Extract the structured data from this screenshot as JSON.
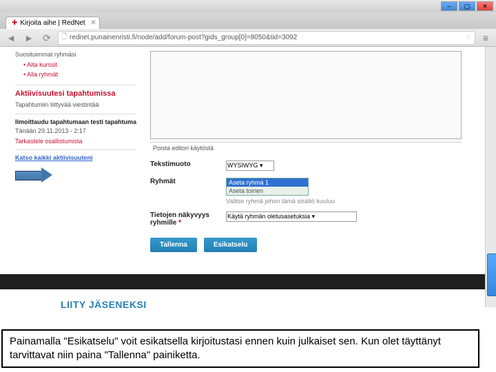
{
  "chrome": {
    "tab_title": "Kirjoita aihe | RedNet",
    "url": "rednet.punainenristi.fi/node/add/forum-post?gids_group[0]=8050&tid=3092",
    "win_min": "–",
    "win_max": "▢",
    "win_close": "✕",
    "tab_close": "✕",
    "back": "◄",
    "fwd": "►",
    "reload": "⟳",
    "star": "☆",
    "menu": "≡"
  },
  "sidebar": {
    "sub": "Suosituimmat ryhmäsi",
    "bullets": [
      "Alta kurssit",
      "Alla ryhmät"
    ],
    "activity_heading": "Aktiivisuutesi tapahtumissa",
    "activity_sub": "Tapahtumiin liittyvää viestintää",
    "signup_heading": "Ilmoittaudu tapahtumaan testi tapahtuma",
    "signup_date": "Tänään 29.11.2013 - 2:17",
    "view_participants": "Tarkastele osallistumista",
    "view_all": "Katso kaikki aktiivisuuteni"
  },
  "form": {
    "toggle_editor": "Poista editori käytöstä",
    "text_format_label": "Tekstimuoto",
    "text_format_value": "WYSIWYG ▾",
    "groups_label": "Ryhmät",
    "group_selected": "Aseta ryhmä 1",
    "group_opt": "Aseta toinen",
    "groups_hint": "Valitse ryhmä johon tämä sisältö kuuluu",
    "visibility_label": "Tietojen näkyvyys ryhmille",
    "visibility_value": "Käytä ryhmän oletusasetuksia ▾",
    "save": "Tallenna",
    "preview": "Esikatselu"
  },
  "footer": {
    "join": "LIITY JÄSENEKSI"
  },
  "overlay": {
    "text": "Painamalla \"Esikatselu\" voit esikatsella kirjoitustasi ennen kuin julkaiset sen. Kun olet täyttänyt tarvittavat niin paina \"Tallenna\" painiketta."
  }
}
